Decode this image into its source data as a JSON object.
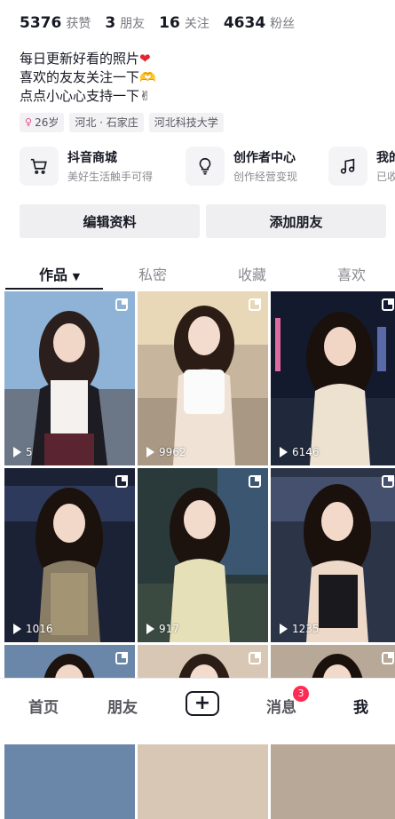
{
  "stats": [
    {
      "value": "5376",
      "label": "获赞"
    },
    {
      "value": "3",
      "label": "朋友"
    },
    {
      "value": "16",
      "label": "关注"
    },
    {
      "value": "4634",
      "label": "粉丝"
    }
  ],
  "bio": {
    "line1": "每日更新好看的照片",
    "line1_emoji": "❤",
    "line2": "喜欢的友友关注一下",
    "line2_emoji": "🫶",
    "line3": "点点小心心支持一下",
    "line3_emoji": "✌"
  },
  "tags": {
    "gender_icon": "♀",
    "age": "26岁",
    "location": "河北 · 石家庄",
    "school": "河北科技大学"
  },
  "services": [
    {
      "title": "抖音商城",
      "subtitle": "美好生活触手可得",
      "icon": "cart-icon"
    },
    {
      "title": "创作者中心",
      "subtitle": "创作经营变现",
      "icon": "bulb-icon"
    },
    {
      "title": "我的",
      "subtitle": "已收",
      "icon": "music-note-icon"
    }
  ],
  "buttons": {
    "edit_profile": "编辑资料",
    "add_friend": "添加朋友"
  },
  "tabs": {
    "works": "作品",
    "private": "私密",
    "favorites": "收藏",
    "likes": "喜欢"
  },
  "videos": [
    {
      "views": "5"
    },
    {
      "views": "9962"
    },
    {
      "views": "6146"
    },
    {
      "views": "1016"
    },
    {
      "views": "917"
    },
    {
      "views": "1235"
    },
    {
      "views": ""
    },
    {
      "views": ""
    },
    {
      "views": ""
    }
  ],
  "nav": {
    "home": "首页",
    "friends": "朋友",
    "messages": "消息",
    "messages_badge": "3",
    "me": "我"
  },
  "colors": {
    "accent_red": "#fe2c55",
    "text_primary": "#161823"
  }
}
